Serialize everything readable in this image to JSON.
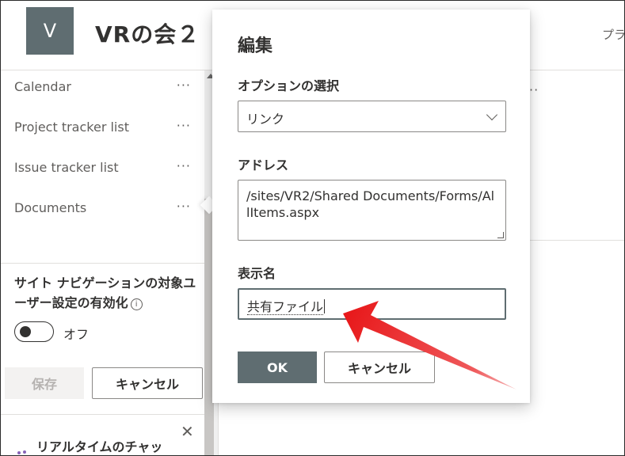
{
  "header": {
    "logo_letter": "V",
    "site_title": "VRの会２",
    "right_text": "プラ"
  },
  "nav": {
    "items": [
      {
        "label": "Calendar",
        "more": "···"
      },
      {
        "label": "Project tracker list",
        "more": "···"
      },
      {
        "label": "Issue tracker list",
        "more": "···"
      },
      {
        "label": "Documents",
        "more": "···"
      }
    ],
    "audience_label": "サイト ナビゲーションの対象ユーザー設定の有効化",
    "info_icon": "i",
    "toggle_state": "off",
    "toggle_label": "オフ",
    "save_label": "保存",
    "cancel_label": "キャンセル"
  },
  "chat": {
    "title": "リアルタイムのチャッ",
    "close_glyph": "✕"
  },
  "main": {
    "more": "··"
  },
  "dialog": {
    "title": "編集",
    "option_label": "オプションの選択",
    "option_value": "リンク",
    "address_label": "アドレス",
    "address_value": "/sites/VR2/Shared Documents/Forms/AllItems.aspx",
    "display_name_label": "表示名",
    "display_name_value": "共有ファイル",
    "ok_label": "OK",
    "cancel_label": "キャンセル"
  },
  "colors": {
    "accent": "#5f6d71",
    "annotation_arrow": "#e8191b"
  },
  "icons": {
    "dropdown": "chevron-down-icon",
    "info": "info-icon",
    "close": "close-icon",
    "annotation": "red-arrow-icon"
  }
}
